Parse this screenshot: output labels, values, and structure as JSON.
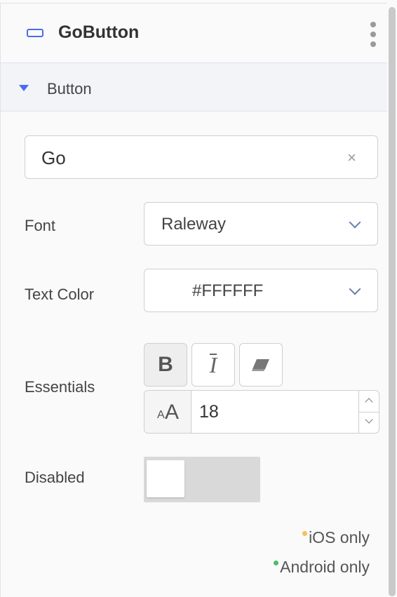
{
  "header": {
    "title": "GoButton",
    "component_icon": "button-component-icon",
    "menu_icon": "kebab-menu-icon"
  },
  "section": {
    "label": "Button",
    "expanded": true
  },
  "text_field": {
    "value": "Go",
    "clear_icon": "×"
  },
  "font": {
    "label": "Font",
    "value": "Raleway"
  },
  "text_color": {
    "label": "Text Color",
    "value": "#FFFFFF"
  },
  "essentials": {
    "label": "Essentials",
    "bold_label": "B",
    "bold_active": true,
    "italic_label": "I",
    "clear_format_icon": "eraser-icon",
    "font_size": "18"
  },
  "disabled": {
    "label": "Disabled",
    "on": false
  },
  "legend": {
    "ios_label": "iOS only",
    "android_label": "Android only",
    "ios_color": "#f5c15a",
    "android_color": "#4cbb6b"
  },
  "colors": {
    "accent": "#4a6cf0"
  }
}
